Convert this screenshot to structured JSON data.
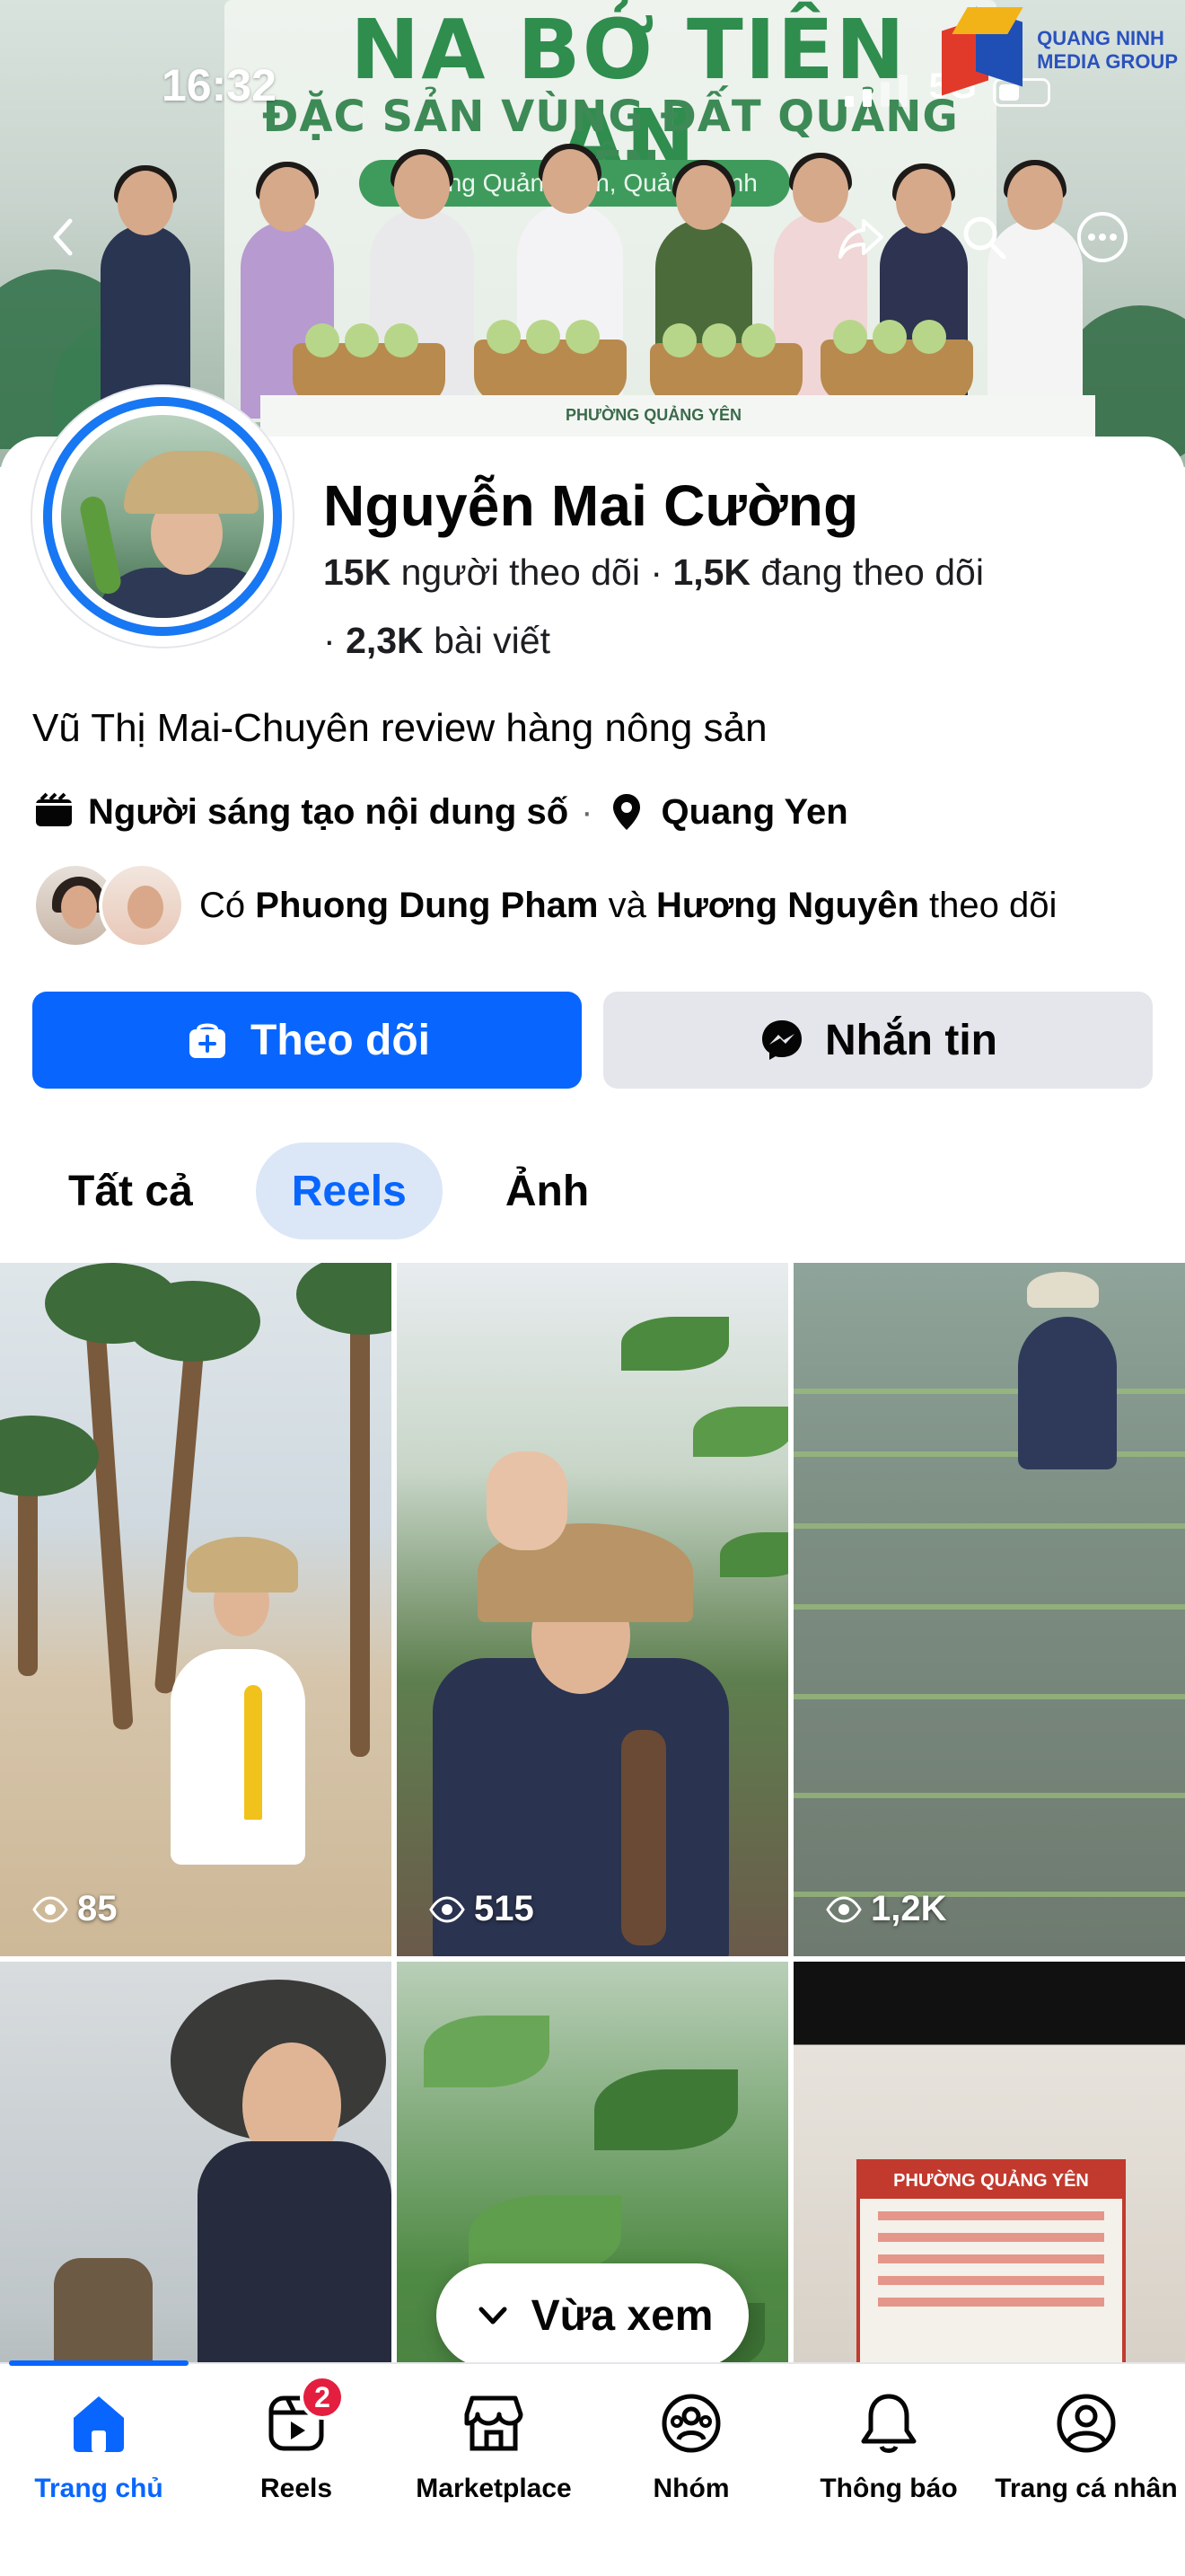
{
  "status_bar": {
    "time": "16:32",
    "network": "5G"
  },
  "cover": {
    "title": "NA BỞ TIÊN AN",
    "subtitle": "ĐẶC SẢN VÙNG ĐẤT QUẢNG YÊN",
    "pill": "Trường Quảng Yên, Quảng Ninh",
    "table_text": "PHƯỜNG QUẢNG YÊN",
    "watermark_line1": "QUANG NINH",
    "watermark_line2": "MEDIA GROUP"
  },
  "profile": {
    "name": "Nguyễn Mai Cường",
    "followers_count": "15K",
    "followers_label": "người theo dõi",
    "following_count": "1,5K",
    "following_label": "đang theo dõi",
    "posts_count": "2,3K",
    "posts_label": "bài viết",
    "bio": "Vũ Thị Mai-Chuyên review hàng nông sản",
    "category": "Người sáng tạo nội dung số",
    "location": "Quang Yen",
    "mutual_prefix": "Có",
    "mutual_name_1": "Phuong Dung Pham",
    "mutual_connector": "và",
    "mutual_name_2": "Hương Nguyên",
    "mutual_suffix": "theo dõi"
  },
  "actions": {
    "follow_label": "Theo dõi",
    "message_label": "Nhắn tin"
  },
  "tabs": [
    {
      "label": "Tất cả",
      "active": false
    },
    {
      "label": "Reels",
      "active": true
    },
    {
      "label": "Ảnh",
      "active": false
    }
  ],
  "reels": [
    {
      "views": "85"
    },
    {
      "views": "515"
    },
    {
      "views": "1,2K"
    },
    {
      "views": ""
    },
    {
      "views": ""
    },
    {
      "views": ""
    }
  ],
  "reel6_poster": {
    "header": "PHƯỜNG QUẢNG YÊN"
  },
  "recent_pill": {
    "label": "Vừa xem"
  },
  "bottom_nav": [
    {
      "label": "Trang chủ",
      "icon": "home-icon",
      "active": true
    },
    {
      "label": "Reels",
      "icon": "reels-icon",
      "badge": "2"
    },
    {
      "label": "Marketplace",
      "icon": "marketplace-icon"
    },
    {
      "label": "Nhóm",
      "icon": "groups-icon"
    },
    {
      "label": "Thông báo",
      "icon": "bell-icon"
    },
    {
      "label": "Trang cá nhân",
      "icon": "profile-icon"
    }
  ],
  "colors": {
    "accent": "#0866ff",
    "badge": "#e41e3f",
    "avatar_ring": "#1877f2"
  }
}
